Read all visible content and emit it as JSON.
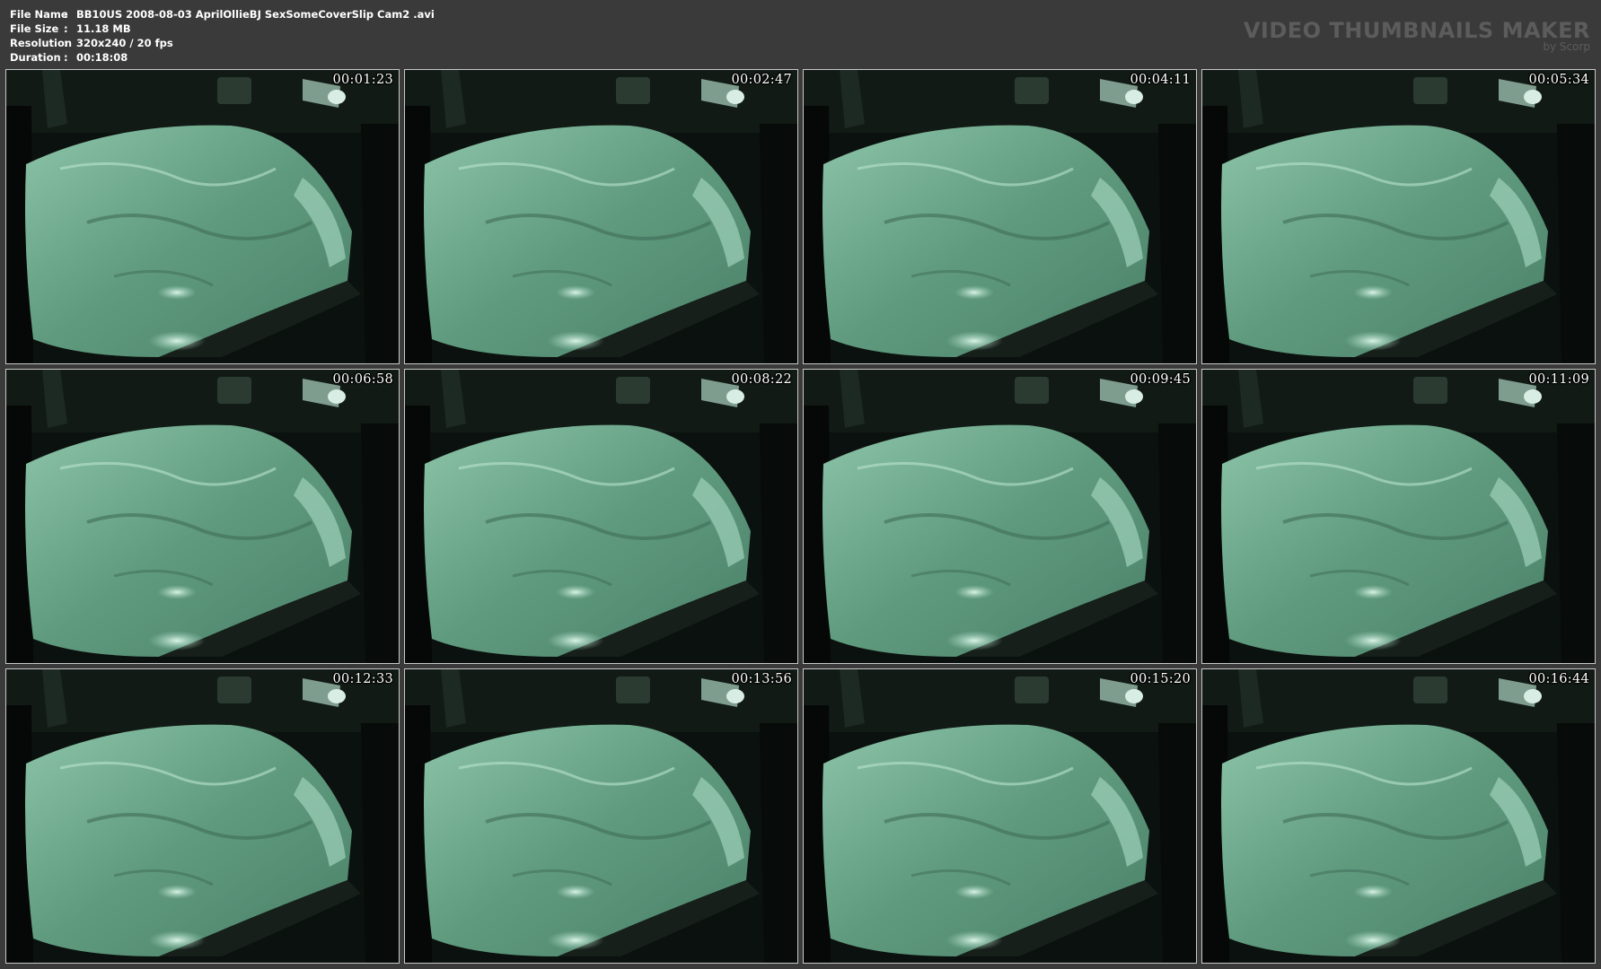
{
  "header": {
    "file_name_label": "File Name",
    "file_name": "BB10US 2008-08-03 AprilOllieBJ SexSomeCoverSlip Cam2 .avi",
    "file_size_label": "File Size",
    "file_size": "11.18 MB",
    "resolution_label": "Resolution",
    "resolution": "320x240 / 20 fps",
    "duration_label": "Duration",
    "duration": "00:18:08",
    "separator": ":"
  },
  "brand": {
    "title": "VIDEO THUMBNAILS MAKER",
    "subtitle": "by Scorp"
  },
  "thumbnails": [
    {
      "timestamp": "00:01:23"
    },
    {
      "timestamp": "00:02:47"
    },
    {
      "timestamp": "00:04:11"
    },
    {
      "timestamp": "00:05:34"
    },
    {
      "timestamp": "00:06:58"
    },
    {
      "timestamp": "00:08:22"
    },
    {
      "timestamp": "00:09:45"
    },
    {
      "timestamp": "00:11:09"
    },
    {
      "timestamp": "00:12:33"
    },
    {
      "timestamp": "00:13:56"
    },
    {
      "timestamp": "00:15:20"
    },
    {
      "timestamp": "00:16:44"
    }
  ],
  "colors": {
    "background": "#3a3a3a",
    "brand_text": "#5c5c5c",
    "night_vision_green": "#6fa88c",
    "dark_room": "#0a0f0c"
  }
}
